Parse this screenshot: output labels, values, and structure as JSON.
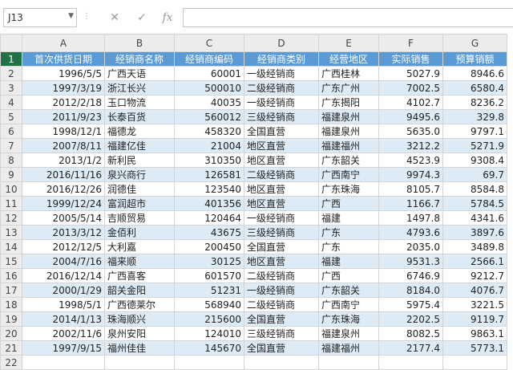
{
  "name_box": "J13",
  "formula_content": "",
  "toolbar_icons": [
    "cancel-icon",
    "enter-icon",
    "function-icon"
  ],
  "column_headers": [
    "A",
    "B",
    "C",
    "D",
    "E",
    "F",
    "G"
  ],
  "header_row": {
    "row": "1",
    "cells": [
      "首次供货日期",
      "经销商名称",
      "经销商编码",
      "经销商类别",
      "经营地区",
      "实际销售",
      "预算销额"
    ]
  },
  "rows": [
    {
      "row": "2",
      "cells": [
        "1996/5/5",
        "广西天语",
        "60001",
        "一级经销商",
        "广西桂林",
        "5027.9",
        "8946.6"
      ]
    },
    {
      "row": "3",
      "cells": [
        "1997/3/19",
        "浙江长兴",
        "500010",
        "二级经销商",
        "广东广州",
        "7002.5",
        "6580.4"
      ]
    },
    {
      "row": "4",
      "cells": [
        "2012/2/18",
        "玉口物流",
        "40035",
        "一级经销商",
        "广东揭阳",
        "4102.7",
        "8236.2"
      ]
    },
    {
      "row": "5",
      "cells": [
        "2011/9/23",
        "长泰百货",
        "560012",
        "三级经销商",
        "福建泉州",
        "9495.6",
        "329.8"
      ]
    },
    {
      "row": "6",
      "cells": [
        "1998/12/1",
        "福德龙",
        "458320",
        "全国直营",
        "福建泉州",
        "5635.0",
        "9797.1"
      ]
    },
    {
      "row": "7",
      "cells": [
        "2007/8/11",
        "福建亿佳",
        "21004",
        "地区直营",
        "福建福州",
        "3212.2",
        "5271.9"
      ]
    },
    {
      "row": "8",
      "cells": [
        "2013/1/2",
        "新利民",
        "310350",
        "地区直营",
        "广东韶关",
        "4523.9",
        "9308.4"
      ]
    },
    {
      "row": "9",
      "cells": [
        "2016/11/16",
        "泉兴商行",
        "126581",
        "二级经销商",
        "广西南宁",
        "9974.3",
        "69.7"
      ]
    },
    {
      "row": "10",
      "cells": [
        "2016/12/26",
        "润德佳",
        "123540",
        "地区直营",
        "广东珠海",
        "8105.7",
        "8584.8"
      ]
    },
    {
      "row": "11",
      "cells": [
        "1999/12/24",
        "富润超市",
        "401356",
        "地区直营",
        "广西",
        "1166.7",
        "5784.5"
      ]
    },
    {
      "row": "12",
      "cells": [
        "2005/5/14",
        "吉顺贸易",
        "120464",
        "一级经销商",
        "福建",
        "1497.8",
        "4341.6"
      ]
    },
    {
      "row": "13",
      "cells": [
        "2013/3/12",
        "金佰利",
        "43675",
        "三级经销商",
        "广东",
        "4793.6",
        "3897.6"
      ]
    },
    {
      "row": "14",
      "cells": [
        "2012/12/5",
        "大利嘉",
        "200450",
        "全国直营",
        "广东",
        "2035.0",
        "3489.8"
      ]
    },
    {
      "row": "15",
      "cells": [
        "2004/7/16",
        "福来顺",
        "30125",
        "地区直营",
        "福建",
        "9531.3",
        "2566.1"
      ]
    },
    {
      "row": "16",
      "cells": [
        "2016/12/14",
        "广西喜客",
        "601570",
        "二级经销商",
        "广西",
        "6746.9",
        "9212.7"
      ]
    },
    {
      "row": "17",
      "cells": [
        "2000/1/29",
        "韶关金阳",
        "51231",
        "一级经销商",
        "广东韶关",
        "8184.0",
        "4076.7"
      ]
    },
    {
      "row": "18",
      "cells": [
        "1998/5/1",
        "广西德莱尔",
        "568940",
        "二级经销商",
        "广西南宁",
        "5975.4",
        "3221.5"
      ]
    },
    {
      "row": "19",
      "cells": [
        "2014/1/13",
        "珠海顺兴",
        "215600",
        "全国直营",
        "广东珠海",
        "2202.5",
        "9119.7"
      ]
    },
    {
      "row": "20",
      "cells": [
        "2002/11/6",
        "泉州安阳",
        "124010",
        "三级经销商",
        "福建泉州",
        "8082.5",
        "9863.1"
      ]
    },
    {
      "row": "21",
      "cells": [
        "1997/9/15",
        "福州佳佳",
        "145670",
        "全国直营",
        "福建福州",
        "2177.4",
        "5773.1"
      ]
    }
  ],
  "empty_rows": [
    "22"
  ],
  "colors": {
    "header_fill": "#5b9bd5",
    "band_fill": "#ddebf7",
    "header_text": "#ffffff",
    "selected_row_header": "#217346"
  }
}
